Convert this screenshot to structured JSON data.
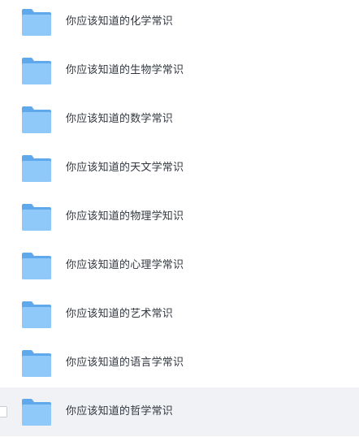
{
  "files": [
    {
      "name": "你应该知道的化学常识",
      "icon": "folder-icon"
    },
    {
      "name": "你应该知道的生物学常识",
      "icon": "folder-icon"
    },
    {
      "name": "你应该知道的数学常识",
      "icon": "folder-icon"
    },
    {
      "name": "你应该知道的天文学常识",
      "icon": "folder-icon"
    },
    {
      "name": "你应该知道的物理学知识",
      "icon": "folder-icon"
    },
    {
      "name": "你应该知道的心理学常识",
      "icon": "folder-icon"
    },
    {
      "name": "你应该知道的艺术常识",
      "icon": "folder-icon"
    },
    {
      "name": "你应该知道的语言学常识",
      "icon": "folder-icon"
    },
    {
      "name": "你应该知道的哲学常识",
      "icon": "folder-icon"
    }
  ],
  "colors": {
    "folder_back": "#5fa8ec",
    "folder_front": "#8ec9f9",
    "hover_row": "#f0f2f5",
    "text": "#333840"
  }
}
